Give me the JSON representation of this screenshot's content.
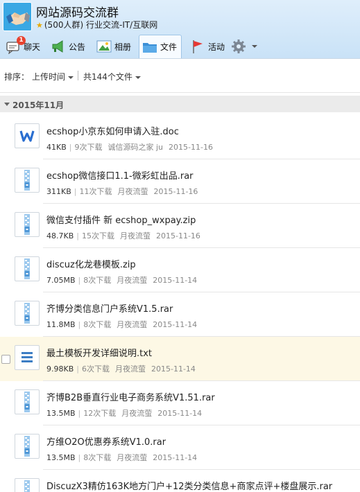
{
  "group": {
    "title": "网站源码交流群",
    "member_count": "(500人群)",
    "category": "行业交流-IT/互联网"
  },
  "toolbar": {
    "chat_label": "聊天",
    "chat_badge": "1",
    "announce_label": "公告",
    "album_label": "相册",
    "files_label": "文件",
    "activity_label": "活动"
  },
  "sortbar": {
    "sort_label": "排序：",
    "sort_value": "上传时间",
    "count_text": "共144个文件"
  },
  "section": {
    "label": "2015年11月"
  },
  "files": [
    {
      "name": "ecshop小京东如何申请入驻.doc",
      "size": "41KB",
      "downloads": "9次下载",
      "uploader": "诚信源码之家 ju",
      "date": "2015-11-16",
      "type": "doc"
    },
    {
      "name": "ecshop微信接口1.1-微彩虹出品.rar",
      "size": "311KB",
      "downloads": "11次下载",
      "uploader": "月夜流萤",
      "date": "2015-11-16",
      "type": "zip"
    },
    {
      "name": "微信支付插件 新 ecshop_wxpay.zip",
      "size": "48.7KB",
      "downloads": "15次下载",
      "uploader": "月夜流萤",
      "date": "2015-11-16",
      "type": "zip"
    },
    {
      "name": "discuz化龙巷模板.zip",
      "size": "7.05MB",
      "downloads": "8次下载",
      "uploader": "月夜流萤",
      "date": "2015-11-14",
      "type": "zip"
    },
    {
      "name": "齐博分类信息门户系统V1.5.rar",
      "size": "11.8MB",
      "downloads": "8次下载",
      "uploader": "月夜流萤",
      "date": "2015-11-14",
      "type": "zip"
    },
    {
      "name": "最土模板开发详细说明.txt",
      "size": "9.98KB",
      "downloads": "6次下载",
      "uploader": "月夜流萤",
      "date": "2015-11-14",
      "type": "txt"
    },
    {
      "name": "齐博B2B垂直行业电子商务系统V1.51.rar",
      "size": "13.5MB",
      "downloads": "12次下载",
      "uploader": "月夜流萤",
      "date": "2015-11-14",
      "type": "zip"
    },
    {
      "name": "方维O2O优惠券系统V1.0.rar",
      "size": "13.5MB",
      "downloads": "8次下载",
      "uploader": "月夜流萤",
      "date": "2015-11-14",
      "type": "zip"
    },
    {
      "name": "DiscuzX3精仿163K地方门户+12类分类信息+商家点评+楼盘展示.rar",
      "size": "",
      "downloads": "",
      "uploader": "",
      "date": "",
      "type": "zip"
    }
  ],
  "colors": {
    "header_bg": "#c9e2f7",
    "highlight_row": "#fdf8e5",
    "doc_icon": "#2b6fd0",
    "zip_icon": "#7db8e8"
  }
}
